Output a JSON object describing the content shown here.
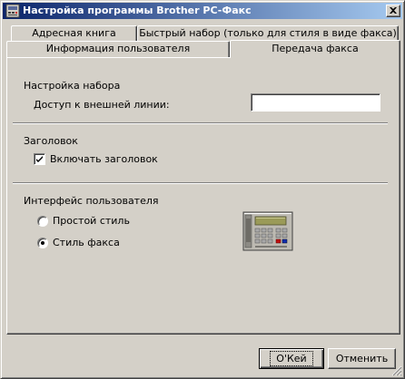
{
  "window": {
    "title": "Настройка программы Brother PC-Факс"
  },
  "tabs": {
    "row1": [
      {
        "label": "Адресная книга"
      },
      {
        "label": "Быстрый набор (только для стиля в виде факса)"
      }
    ],
    "row2": [
      {
        "label": "Информация пользователя"
      },
      {
        "label": "Передача факса",
        "selected": true
      }
    ]
  },
  "dial_settings": {
    "heading": "Настройка набора",
    "outside_line_label": "Доступ к внешней линии:",
    "outside_line_value": ""
  },
  "header_settings": {
    "heading": "Заголовок",
    "include_header_label": "Включать заголовок",
    "include_header_checked": true
  },
  "user_interface": {
    "heading": "Интерфейс пользователя",
    "options": [
      {
        "label": "Простой стиль",
        "checked": false
      },
      {
        "label": "Стиль факса",
        "checked": true
      }
    ]
  },
  "buttons": {
    "ok_label": "O'Кей",
    "cancel_label": "Отменить"
  },
  "icons": {
    "app": "brother-app-icon",
    "close": "close-icon",
    "fax": "fax-machine-icon"
  }
}
